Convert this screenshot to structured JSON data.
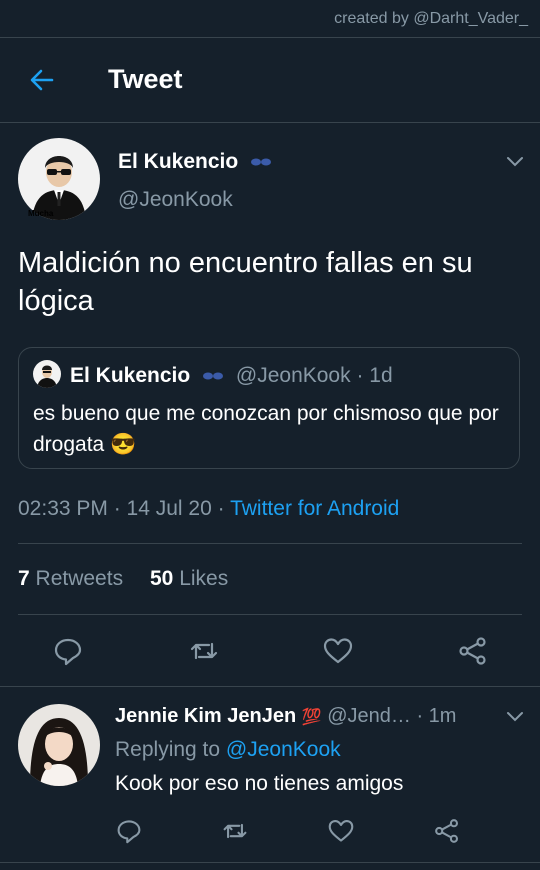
{
  "watermark": "created by @Darht_Vader_",
  "header": {
    "title": "Tweet"
  },
  "tweet": {
    "author_name": "El Kukencio",
    "author_handle": "@JeonKook",
    "avatar_caption": "Mucha",
    "text": "Maldición no encuentro fallas en su lógica",
    "quote": {
      "author_name": "El Kukencio",
      "author_handle": "@JeonKook",
      "time": "· 1d",
      "text": "es bueno que me conozcan por chismoso que por drogata 😎"
    },
    "time": "02:33 PM",
    "date_sep": "· 14 Jul 20 ·",
    "source": "Twitter for Android",
    "stats": {
      "retweets_count": "7",
      "retweets_label": "Retweets",
      "likes_count": "50",
      "likes_label": "Likes"
    }
  },
  "reply": {
    "author_name": "Jennie Kim JenJen",
    "badge": "💯",
    "author_handle": "@Jend…",
    "time": "· 1m",
    "replying_prefix": "Replying to",
    "replying_to": "@JeonKook",
    "text": "Kook por eso no tienes amigos"
  },
  "icons": {
    "back": "arrow-left-icon",
    "reply": "comment-icon",
    "retweet": "retweet-icon",
    "like": "heart-icon",
    "share": "share-icon",
    "more": "chevron-down-icon"
  },
  "colors": {
    "background": "#15202b",
    "accent": "#1da1f2",
    "muted": "#8899a6",
    "divider": "#38444d",
    "badge_red": "#e0245e"
  }
}
